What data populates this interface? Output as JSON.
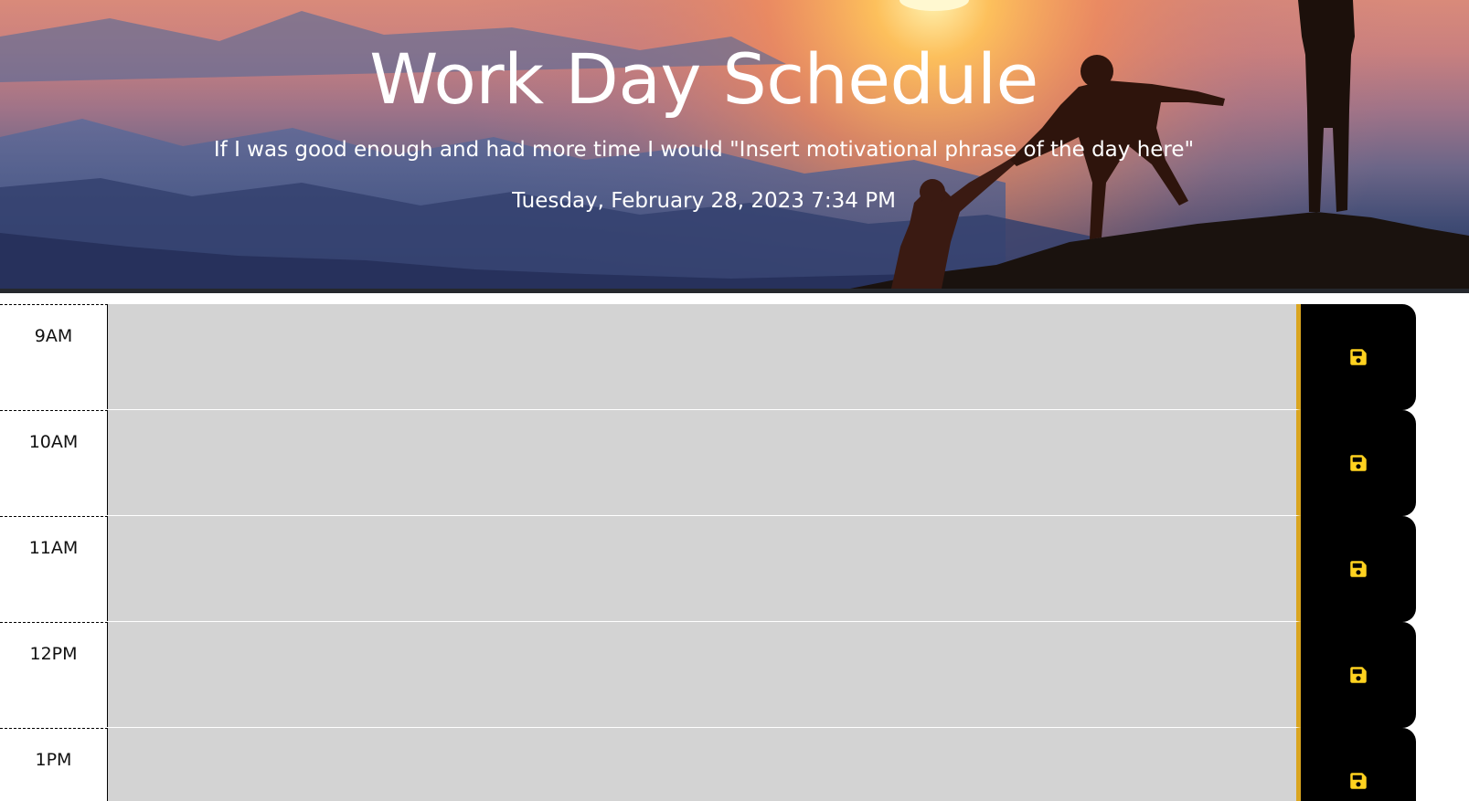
{
  "header": {
    "title": "Work Day Schedule",
    "lead": "If I was good enough and had more time I would \"Insert motivational phrase of the day here\"",
    "current_date": "Tuesday, February 28, 2023 7:34 PM"
  },
  "colors": {
    "past_block": "#d3d3d3",
    "save_button_bg": "#000000",
    "save_icon": "#ffd21f",
    "accent_border": "#daa520"
  },
  "schedule": {
    "blocks": [
      {
        "hour": "9AM",
        "text": "",
        "save_icon": "floppy-disk-icon"
      },
      {
        "hour": "10AM",
        "text": "",
        "save_icon": "floppy-disk-icon"
      },
      {
        "hour": "11AM",
        "text": "",
        "save_icon": "floppy-disk-icon"
      },
      {
        "hour": "12PM",
        "text": "",
        "save_icon": "floppy-disk-icon"
      },
      {
        "hour": "1PM",
        "text": "",
        "save_icon": "floppy-disk-icon"
      }
    ]
  }
}
